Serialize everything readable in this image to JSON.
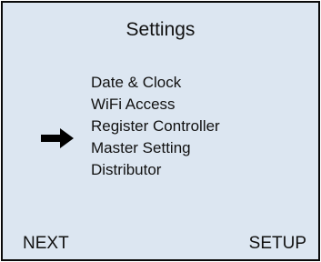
{
  "screen": {
    "title": "Settings",
    "menu": {
      "items": [
        {
          "label": "Date & Clock"
        },
        {
          "label": "WiFi Access"
        },
        {
          "label": "Register Controller"
        },
        {
          "label": "Master Setting"
        },
        {
          "label": "Distributor"
        }
      ],
      "selected_index": 2,
      "selector_icon": "arrow-right-icon"
    },
    "softkeys": {
      "left": "NEXT",
      "right": "SETUP"
    },
    "colors": {
      "background": "#dce6f1",
      "border": "#0a0a0a",
      "text": "#111111"
    }
  }
}
